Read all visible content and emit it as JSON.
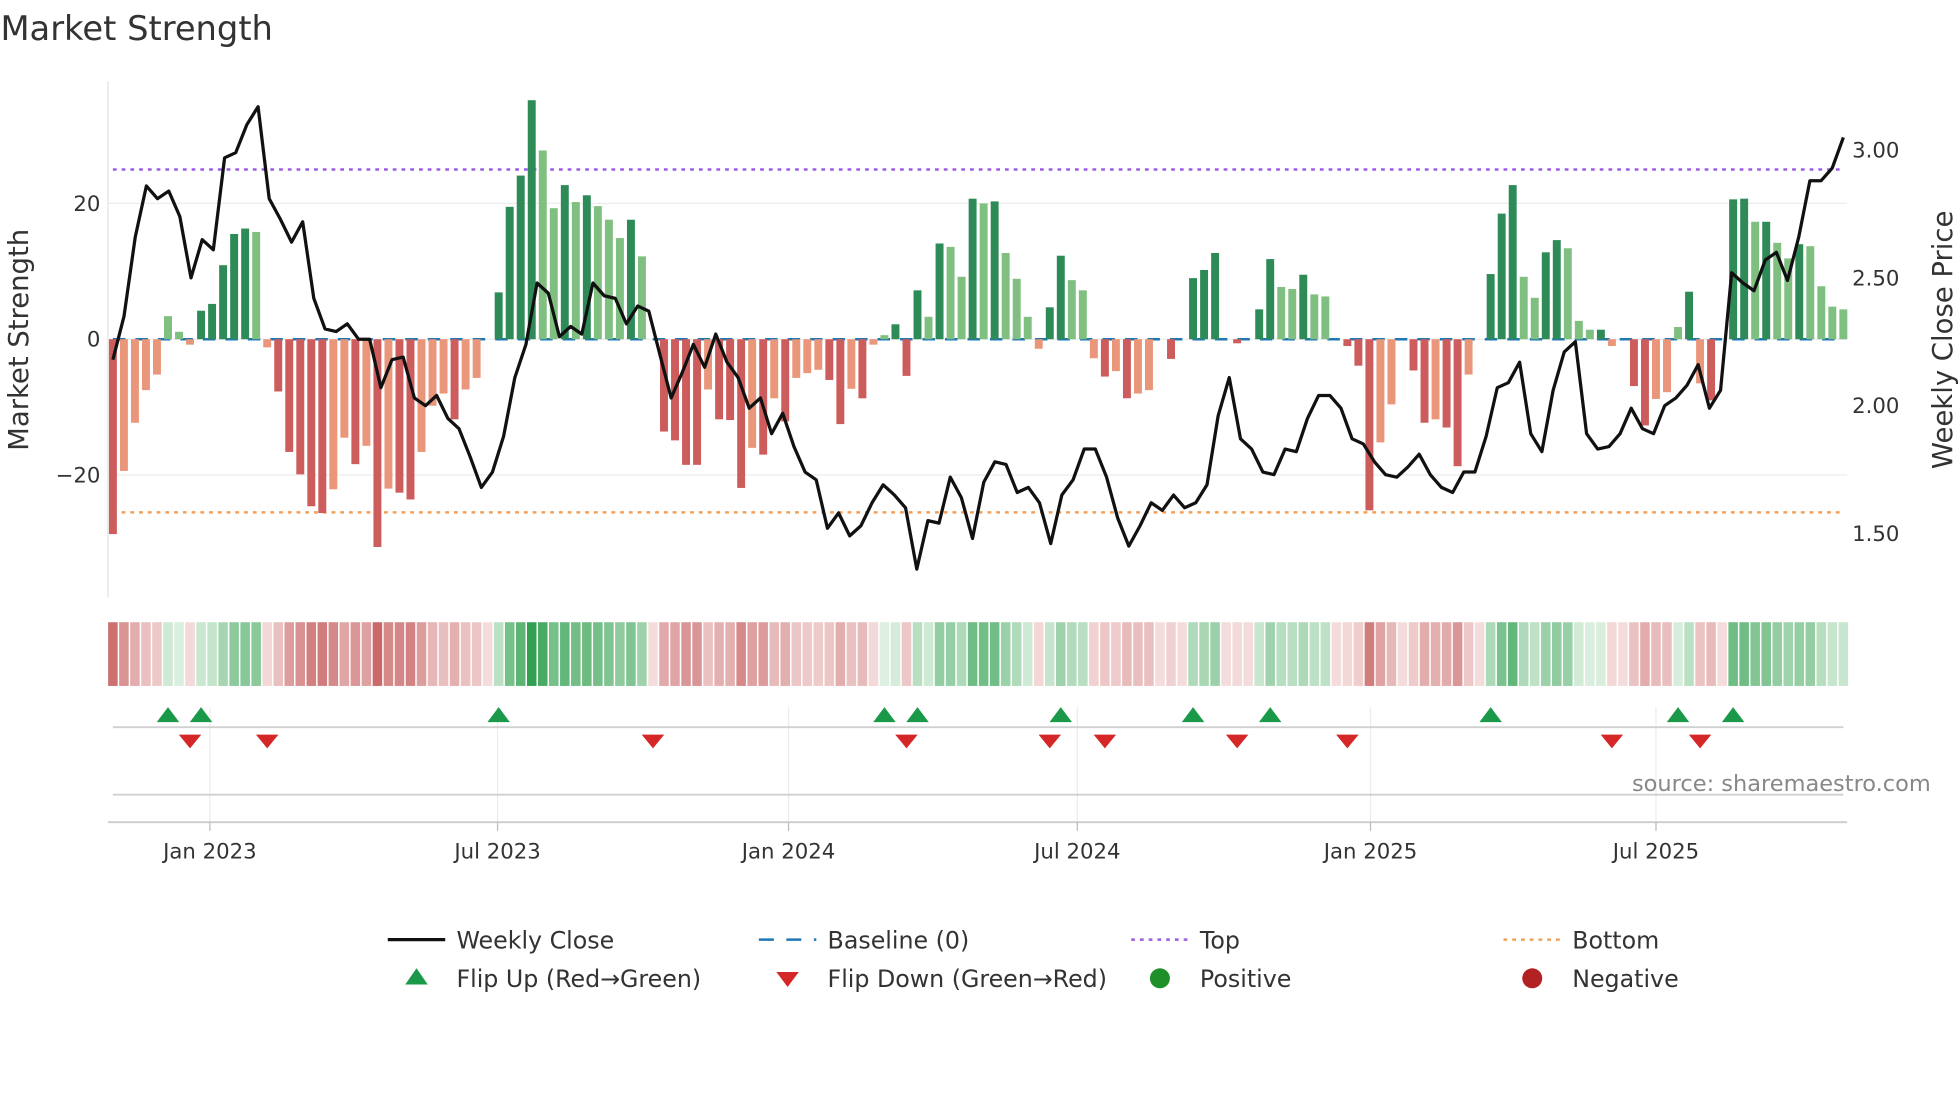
{
  "chart_data": {
    "type": "bar",
    "title": "Market Strength",
    "ylabel": "Market Strength",
    "y2label": "Weekly Close Price",
    "ylim": [
      -38,
      38
    ],
    "y2lim": [
      1.25,
      3.27
    ],
    "yticks": [
      20,
      0,
      -20
    ],
    "ytick_labels": [
      "20",
      "0",
      "−20"
    ],
    "y2ticks": [
      3.0,
      2.5,
      2.0,
      1.5
    ],
    "y2tick_labels": [
      "3.00",
      "2.50",
      "2.00",
      "1.50"
    ],
    "xticks": [
      {
        "label": "Jan 2023",
        "week": 8.8
      },
      {
        "label": "Jul 2023",
        "week": 34.9
      },
      {
        "label": "Jan 2024",
        "week": 61.3
      },
      {
        "label": "Jul 2024",
        "week": 87.5
      },
      {
        "label": "Jan 2025",
        "week": 114.1
      },
      {
        "label": "Jul 2025",
        "week": 140.0
      }
    ],
    "top_level": 25,
    "bottom_level": -25.5,
    "baseline": 0,
    "strength": [
      -28.7,
      -19.4,
      -12.3,
      -7.5,
      -5.2,
      3.4,
      1.1,
      -0.8,
      4.2,
      5.2,
      10.9,
      15.5,
      16.3,
      15.8,
      -1.2,
      -7.7,
      -16.6,
      -19.9,
      -24.6,
      -25.6,
      -22.1,
      -14.5,
      -18.4,
      -15.7,
      -30.6,
      -22,
      -22.6,
      -23.6,
      -16.6,
      -9.8,
      -8,
      -11.8,
      -7.4,
      -5.7,
      0,
      6.9,
      19.5,
      24.1,
      35.2,
      27.8,
      19.3,
      22.7,
      20.2,
      21.2,
      19.6,
      17.6,
      14.9,
      17.6,
      12.2,
      0,
      -13.6,
      -14.9,
      -18.5,
      -18.5,
      -7.4,
      -11.8,
      -11.9,
      -21.9,
      -16,
      -17,
      -8.7,
      -12.1,
      -5.7,
      -5,
      -4.5,
      -6,
      -12.5,
      -7.3,
      -8.7,
      -0.8,
      0.6,
      2.2,
      -5.4,
      7.2,
      3.3,
      14.1,
      13.6,
      9.2,
      20.7,
      20,
      20.3,
      12.7,
      8.9,
      3.3,
      -1.4,
      4.7,
      12.3,
      8.7,
      7.2,
      -2.8,
      -5.5,
      -4.7,
      -8.7,
      -8,
      -7.5,
      0,
      -2.9,
      0,
      9,
      10.2,
      12.7,
      0,
      -0.6,
      0,
      4.4,
      11.8,
      7.7,
      7.4,
      9.5,
      6.6,
      6.3,
      0,
      -1,
      -3.9,
      -25.2,
      -15.2,
      -9.6,
      0,
      -4.6,
      -12.3,
      -11.8,
      -13,
      -18.7,
      -5.2,
      0,
      9.6,
      18.5,
      22.7,
      9.2,
      6.1,
      12.8,
      14.6,
      13.4,
      2.7,
      1.4,
      1.4,
      -1,
      0,
      -6.9,
      -12.7,
      -8.8,
      -7.8,
      1.8,
      7,
      -6.5,
      -9,
      0,
      20.6,
      20.7,
      17.3,
      17.3,
      14.2,
      11.9,
      14,
      13.7,
      7.8,
      4.8,
      4.4
    ],
    "weekly_close": [
      2.18,
      2.35,
      2.66,
      2.86,
      2.81,
      2.84,
      2.74,
      2.5,
      2.65,
      2.61,
      2.97,
      2.99,
      3.1,
      3.17,
      2.81,
      2.73,
      2.64,
      2.72,
      2.42,
      2.3,
      2.29,
      2.32,
      2.26,
      2.26,
      2.07,
      2.18,
      2.19,
      2.03,
      2.0,
      2.04,
      1.95,
      1.91,
      1.8,
      1.68,
      1.74,
      1.88,
      2.11,
      2.24,
      2.48,
      2.44,
      2.27,
      2.31,
      2.28,
      2.48,
      2.43,
      2.42,
      2.32,
      2.39,
      2.37,
      2.2,
      2.03,
      2.13,
      2.24,
      2.15,
      2.28,
      2.17,
      2.11,
      1.99,
      2.03,
      1.89,
      1.97,
      1.84,
      1.74,
      1.71,
      1.52,
      1.58,
      1.49,
      1.53,
      1.62,
      1.69,
      1.65,
      1.6,
      1.36,
      1.55,
      1.54,
      1.72,
      1.64,
      1.48,
      1.7,
      1.78,
      1.77,
      1.66,
      1.68,
      1.62,
      1.46,
      1.65,
      1.71,
      1.83,
      1.83,
      1.72,
      1.56,
      1.45,
      1.53,
      1.62,
      1.59,
      1.65,
      1.6,
      1.62,
      1.69,
      1.96,
      2.11,
      1.87,
      1.83,
      1.74,
      1.73,
      1.83,
      1.82,
      1.95,
      2.04,
      2.04,
      1.99,
      1.87,
      1.85,
      1.78,
      1.73,
      1.72,
      1.76,
      1.81,
      1.73,
      1.68,
      1.66,
      1.74,
      1.74,
      1.88,
      2.07,
      2.09,
      2.17,
      1.89,
      1.82,
      2.06,
      2.21,
      2.25,
      1.89,
      1.83,
      1.84,
      1.89,
      1.99,
      1.91,
      1.89,
      2.0,
      2.03,
      2.08,
      2.16,
      1.99,
      2.06,
      2.52,
      2.48,
      2.45,
      2.57,
      2.6,
      2.49,
      2.66,
      2.88,
      2.88,
      2.93,
      3.05
    ],
    "flip_up_weeks": [
      5,
      8,
      35,
      70,
      73,
      86,
      98,
      105,
      125,
      142,
      147
    ],
    "flip_down_weeks": [
      7,
      14,
      49,
      72,
      85,
      90,
      102,
      112,
      136,
      144
    ],
    "legend": {
      "placement": "bottom",
      "items": [
        {
          "label": "Weekly Close",
          "kind": "line",
          "color": "#111111"
        },
        {
          "label": "Baseline (0)",
          "kind": "dash",
          "color": "#1f77b4"
        },
        {
          "label": "Top",
          "kind": "dot",
          "color": "#9b5de5"
        },
        {
          "label": "Bottom",
          "kind": "dot",
          "color": "#f0a05a"
        },
        {
          "label": "Flip Up (Red→Green)",
          "kind": "tri-up",
          "color": "#1a9a48"
        },
        {
          "label": "Flip Down (Green→Red)",
          "kind": "tri-down",
          "color": "#d62728"
        },
        {
          "label": "Positive",
          "kind": "circle",
          "color": "#1f8f2a"
        },
        {
          "label": "Negative",
          "kind": "circle",
          "color": "#b22222"
        }
      ]
    },
    "source": "source: sharemaestro.com",
    "colors": {
      "pos_strong": "#2e8b57",
      "pos_weak": "#7fbf7f",
      "neg_strong": "#cd5c5c",
      "neg_weak": "#e9967a",
      "top": "#9b5de5",
      "bottom": "#f0a05a",
      "baseline": "#1f77b4",
      "line": "#111111"
    }
  }
}
